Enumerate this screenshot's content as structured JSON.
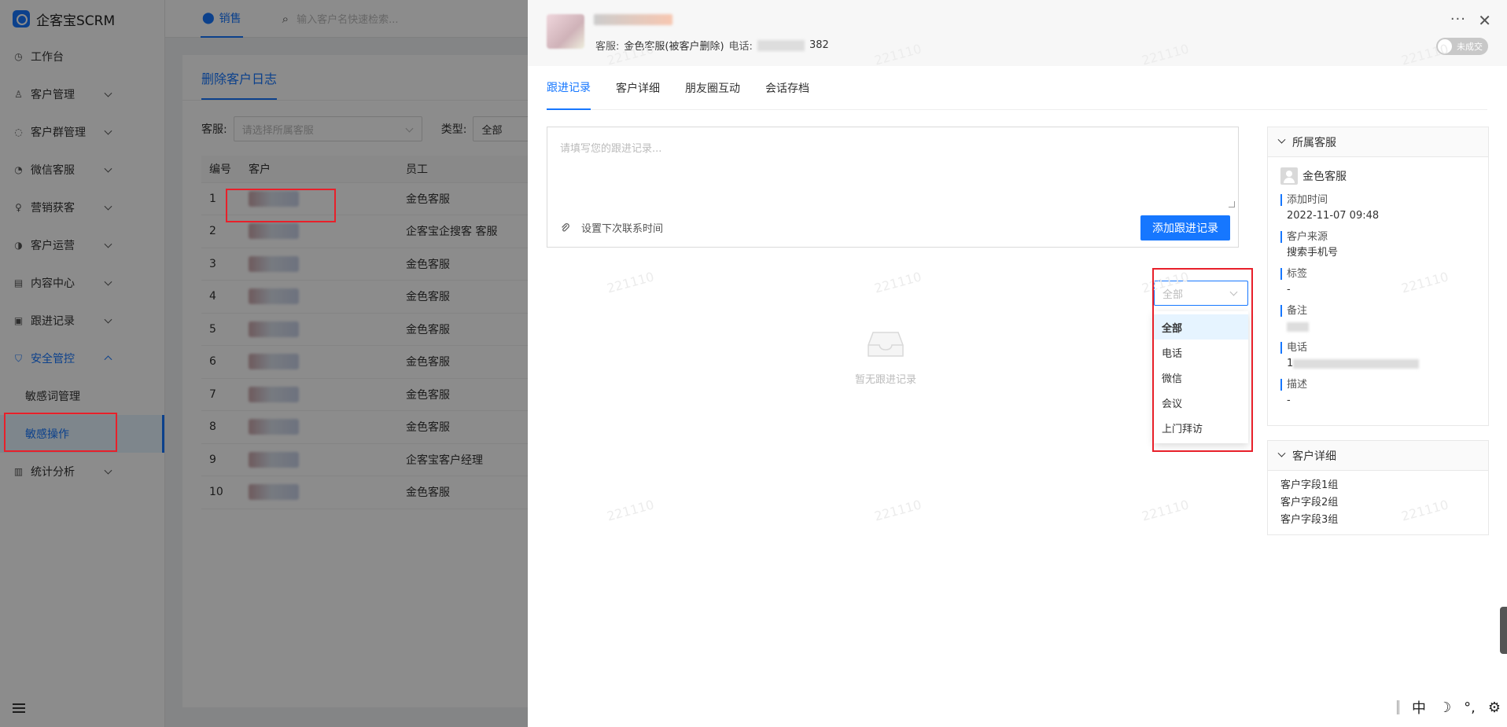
{
  "app": {
    "name": "企客宝SCRM"
  },
  "sidebar": {
    "items": [
      {
        "label": "工作台",
        "icon": "dashboard-icon",
        "has_arrow": false
      },
      {
        "label": "客户管理",
        "icon": "user-icon",
        "has_arrow": true
      },
      {
        "label": "客户群管理",
        "icon": "chat-icon",
        "has_arrow": true
      },
      {
        "label": "微信客服",
        "icon": "message-icon",
        "has_arrow": true
      },
      {
        "label": "营销获客",
        "icon": "bulb-icon",
        "has_arrow": true
      },
      {
        "label": "客户运营",
        "icon": "operation-icon",
        "has_arrow": true
      },
      {
        "label": "内容中心",
        "icon": "content-icon",
        "has_arrow": true
      },
      {
        "label": "跟进记录",
        "icon": "record-icon",
        "has_arrow": true
      },
      {
        "label": "安全管控",
        "icon": "shield-icon",
        "has_arrow": true,
        "open": true
      },
      {
        "label": "统计分析",
        "icon": "chart-icon",
        "has_arrow": true
      }
    ],
    "security_sub": [
      "敏感词管理",
      "敏感操作"
    ]
  },
  "topbar": {
    "tab_label": "销售",
    "search_placeholder": "输入客户名快速检索..."
  },
  "content": {
    "title": "删除客户日志",
    "filter_staff_label": "客服:",
    "filter_staff_placeholder": "请选择所属客服",
    "filter_type_label": "类型:",
    "filter_type_value": "全部",
    "table_headers": [
      "编号",
      "客户",
      "员工"
    ],
    "table_rows": [
      {
        "no": "1",
        "staff": "金色客服"
      },
      {
        "no": "2",
        "staff": "企客宝企搜客 客服"
      },
      {
        "no": "3",
        "staff": "金色客服"
      },
      {
        "no": "4",
        "staff": "金色客服"
      },
      {
        "no": "5",
        "staff": "金色客服"
      },
      {
        "no": "6",
        "staff": "金色客服"
      },
      {
        "no": "7",
        "staff": "金色客服"
      },
      {
        "no": "8",
        "staff": "金色客服"
      },
      {
        "no": "9",
        "staff": "企客宝客户经理"
      },
      {
        "no": "10",
        "staff": "金色客服"
      }
    ]
  },
  "drawer": {
    "info_staff_label": "客服:",
    "info_staff_value": "金色客服(被客户删除)",
    "info_phone_label": "电话:",
    "info_phone_suffix": "382",
    "toggle_text": "未成交",
    "tabs": [
      "跟进记录",
      "客户详细",
      "朋友圈互动",
      "会话存档"
    ],
    "followup_placeholder": "请填写您的跟进记录...",
    "next_contact_label": "设置下次联系时间",
    "add_button": "添加跟进记录",
    "type_select_value": "全部",
    "type_options": [
      "全部",
      "电话",
      "微信",
      "会议",
      "上门拜访"
    ],
    "empty_text": "暂无跟进记录",
    "staff_panel": {
      "title": "所属客服",
      "staff_name": "金色客服",
      "fields": [
        {
          "label": "添加时间",
          "value": "2022-11-07 09:48"
        },
        {
          "label": "客户来源",
          "value": "搜索手机号"
        },
        {
          "label": "标签",
          "value": "-"
        },
        {
          "label": "备注",
          "value": ""
        },
        {
          "label": "电话",
          "value": "1"
        },
        {
          "label": "描述",
          "value": "-"
        }
      ]
    },
    "detail_panel": {
      "title": "客户详细",
      "rows": [
        "客户字段1组",
        "客户字段2组",
        "客户字段3组"
      ]
    },
    "watermark": "221110"
  },
  "ime": {
    "lang": "中",
    "moon": "☽",
    "punct": "°,",
    "gear": "⚙"
  }
}
